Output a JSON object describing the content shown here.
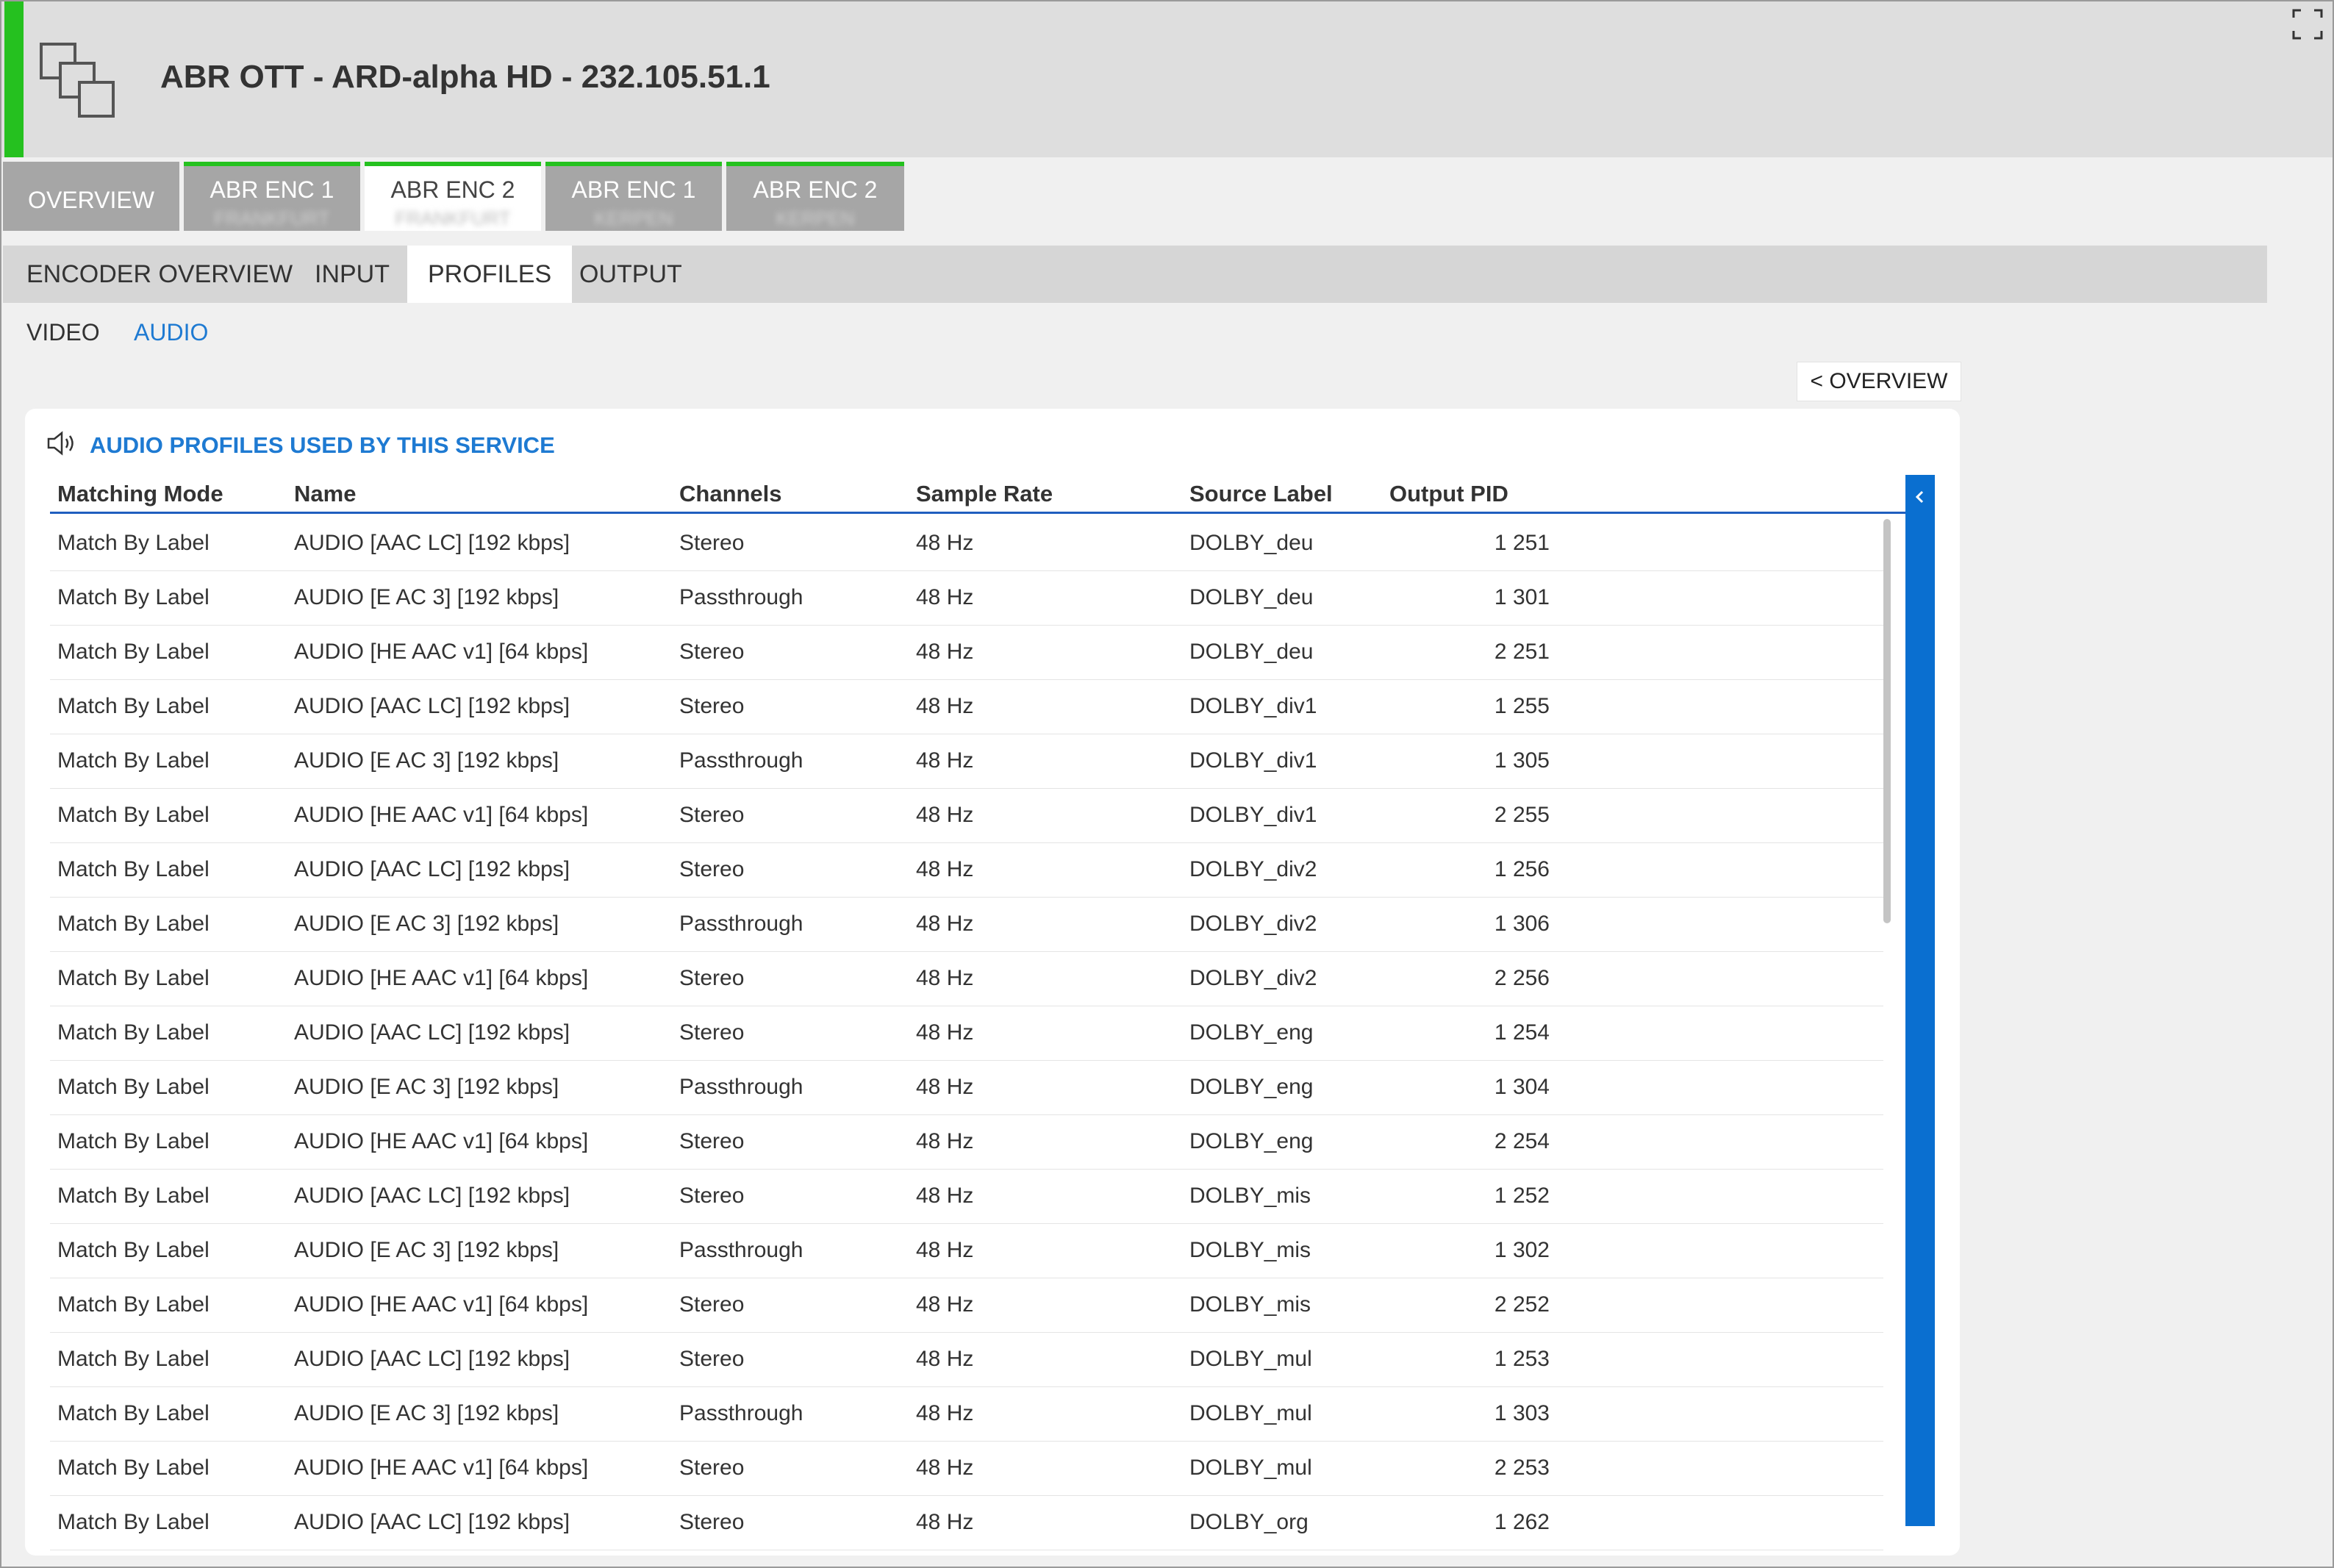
{
  "header": {
    "title": "ABR OTT - ARD-alpha HD - 232.105.51.1",
    "accent_color": "#25c11f",
    "icon": "service-windows-icon"
  },
  "top_tabs": [
    {
      "label": "OVERVIEW",
      "sub": ""
    },
    {
      "label": "ABR ENC 1",
      "sub": "FRANKFURT"
    },
    {
      "label": "ABR ENC 2",
      "sub": "FRANKFURT"
    },
    {
      "label": "ABR ENC 1",
      "sub": "KERPEN"
    },
    {
      "label": "ABR ENC 2",
      "sub": "KERPEN"
    }
  ],
  "sub_tabs": [
    "ENCODER OVERVIEW",
    "INPUT",
    "PROFILES",
    "OUTPUT"
  ],
  "media_switch": {
    "video": "VIDEO",
    "audio": "AUDIO"
  },
  "overview_button": "< OVERVIEW",
  "panel": {
    "title": "AUDIO PROFILES USED BY THIS SERVICE",
    "columns": [
      "Matching Mode",
      "Name",
      "Channels",
      "Sample Rate",
      "Source Label",
      "Output PID"
    ],
    "rows": [
      [
        "Match By Label",
        "AUDIO [AAC LC] [192 kbps]",
        "Stereo",
        "48 Hz",
        "DOLBY_deu",
        "1 251"
      ],
      [
        "Match By Label",
        "AUDIO [E AC 3] [192 kbps]",
        "Passthrough",
        "48 Hz",
        "DOLBY_deu",
        "1 301"
      ],
      [
        "Match By Label",
        "AUDIO [HE AAC v1] [64 kbps]",
        "Stereo",
        "48 Hz",
        "DOLBY_deu",
        "2 251"
      ],
      [
        "Match By Label",
        "AUDIO [AAC LC] [192 kbps]",
        "Stereo",
        "48 Hz",
        "DOLBY_div1",
        "1 255"
      ],
      [
        "Match By Label",
        "AUDIO [E AC 3] [192 kbps]",
        "Passthrough",
        "48 Hz",
        "DOLBY_div1",
        "1 305"
      ],
      [
        "Match By Label",
        "AUDIO [HE AAC v1] [64 kbps]",
        "Stereo",
        "48 Hz",
        "DOLBY_div1",
        "2 255"
      ],
      [
        "Match By Label",
        "AUDIO [AAC LC] [192 kbps]",
        "Stereo",
        "48 Hz",
        "DOLBY_div2",
        "1 256"
      ],
      [
        "Match By Label",
        "AUDIO [E AC 3] [192 kbps]",
        "Passthrough",
        "48 Hz",
        "DOLBY_div2",
        "1 306"
      ],
      [
        "Match By Label",
        "AUDIO [HE AAC v1] [64 kbps]",
        "Stereo",
        "48 Hz",
        "DOLBY_div2",
        "2 256"
      ],
      [
        "Match By Label",
        "AUDIO [AAC LC] [192 kbps]",
        "Stereo",
        "48 Hz",
        "DOLBY_eng",
        "1 254"
      ],
      [
        "Match By Label",
        "AUDIO [E AC 3] [192 kbps]",
        "Passthrough",
        "48 Hz",
        "DOLBY_eng",
        "1 304"
      ],
      [
        "Match By Label",
        "AUDIO [HE AAC v1] [64 kbps]",
        "Stereo",
        "48 Hz",
        "DOLBY_eng",
        "2 254"
      ],
      [
        "Match By Label",
        "AUDIO [AAC LC] [192 kbps]",
        "Stereo",
        "48 Hz",
        "DOLBY_mis",
        "1 252"
      ],
      [
        "Match By Label",
        "AUDIO [E AC 3] [192 kbps]",
        "Passthrough",
        "48 Hz",
        "DOLBY_mis",
        "1 302"
      ],
      [
        "Match By Label",
        "AUDIO [HE AAC v1] [64 kbps]",
        "Stereo",
        "48 Hz",
        "DOLBY_mis",
        "2 252"
      ],
      [
        "Match By Label",
        "AUDIO [AAC LC] [192 kbps]",
        "Stereo",
        "48 Hz",
        "DOLBY_mul",
        "1 253"
      ],
      [
        "Match By Label",
        "AUDIO [E AC 3] [192 kbps]",
        "Passthrough",
        "48 Hz",
        "DOLBY_mul",
        "1 303"
      ],
      [
        "Match By Label",
        "AUDIO [HE AAC v1] [64 kbps]",
        "Stereo",
        "48 Hz",
        "DOLBY_mul",
        "2 253"
      ],
      [
        "Match By Label",
        "AUDIO [AAC LC] [192 kbps]",
        "Stereo",
        "48 Hz",
        "DOLBY_org",
        "1 262"
      ]
    ]
  },
  "colors": {
    "link_blue": "#1e7ad2",
    "side_bar_blue": "#0a6fd0",
    "tab_gray": "#a6a6a6"
  }
}
